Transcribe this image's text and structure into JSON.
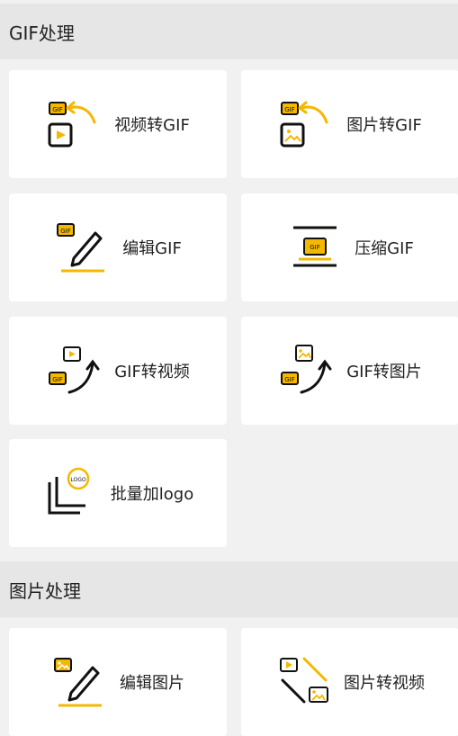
{
  "gif_section": {
    "title": "GIF处理",
    "items": [
      {
        "label": "视频转GIF",
        "icon": "video-to-gif-icon"
      },
      {
        "label": "图片转GIF",
        "icon": "image-to-gif-icon"
      },
      {
        "label": "编辑GIF",
        "icon": "edit-gif-icon"
      },
      {
        "label": "压缩GIF",
        "icon": "compress-gif-icon"
      },
      {
        "label": "GIF转视频",
        "icon": "gif-to-video-icon"
      },
      {
        "label": "GIF转图片",
        "icon": "gif-to-image-icon"
      },
      {
        "label": "批量加logo",
        "icon": "batch-logo-icon"
      }
    ]
  },
  "image_section": {
    "title": "图片处理",
    "items": [
      {
        "label": "编辑图片",
        "icon": "edit-image-icon"
      },
      {
        "label": "图片转视频",
        "icon": "image-to-video-icon"
      }
    ]
  },
  "icon_text": {
    "gif": "GIF",
    "logo": "LOGO"
  },
  "colors": {
    "accent": "#f5b800",
    "dark": "#111111",
    "header_bg": "#e6e6e6",
    "page_bg": "#f1f1f1",
    "card_bg": "#ffffff"
  }
}
